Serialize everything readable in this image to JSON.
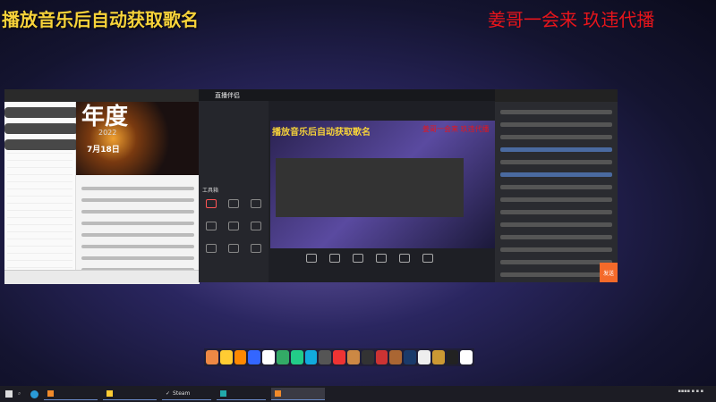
{
  "overlay": {
    "left_title": "播放音乐后自动获取歌名",
    "right_title": "姜哥一会来 玖违代播"
  },
  "left_window": {
    "banner_title": "年度",
    "banner_year": "2022",
    "banner_date": "7月18日"
  },
  "middle_window": {
    "app_name": "直播伴侣",
    "toolbox_label": "工具箱"
  },
  "right_window": {
    "send_label": "发送"
  },
  "taskbar": {
    "items": [
      "",
      "",
      "Steam",
      "",
      ""
    ]
  }
}
